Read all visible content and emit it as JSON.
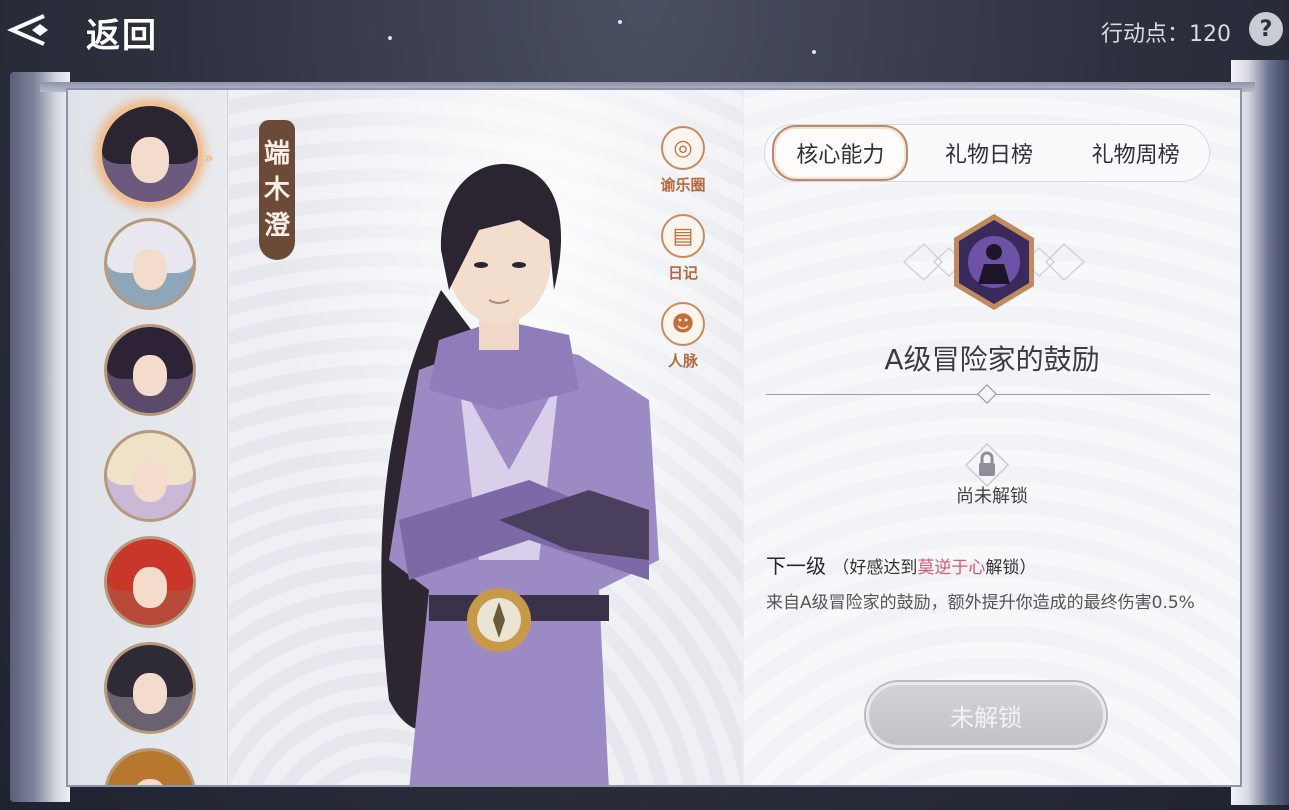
{
  "header": {
    "back_label": "返回",
    "action_points_label": "行动点：120",
    "help_label": "?"
  },
  "character": {
    "name_chars": [
      "端",
      "木",
      "澄"
    ]
  },
  "side_buttons": [
    {
      "label": "谕乐圈",
      "icon": "spiral-icon"
    },
    {
      "label": "日记",
      "icon": "diary-icon"
    },
    {
      "label": "人脉",
      "icon": "people-icon"
    }
  ],
  "avatars": [
    {
      "selected": true,
      "hair": "#2a2530"
    },
    {
      "selected": false,
      "hair": "#e8e6ee"
    },
    {
      "selected": false,
      "hair": "#2c2436"
    },
    {
      "selected": false,
      "hair": "#efe2c8"
    },
    {
      "selected": false,
      "hair": "#c8372a"
    },
    {
      "selected": false,
      "hair": "#2e2a36"
    },
    {
      "selected": false,
      "hair": "#b7772f"
    }
  ],
  "tabs": [
    "核心能力",
    "礼物日榜",
    "礼物周榜"
  ],
  "skill": {
    "name": "A级冒险家的鼓励",
    "locked_text": "尚未解锁",
    "next_level_label": "下一级",
    "condition_prefix": "（好感达到",
    "condition_highlight": "莫逆于心",
    "condition_suffix": "解锁）",
    "description": "来自A级冒险家的鼓励，额外提升你造成的最终伤害0.5%",
    "button_label": "未解锁"
  },
  "colors": {
    "accent_pink": "#d9566f",
    "tab_border": "#b98b6c",
    "selected_glow": "#f0c090"
  }
}
